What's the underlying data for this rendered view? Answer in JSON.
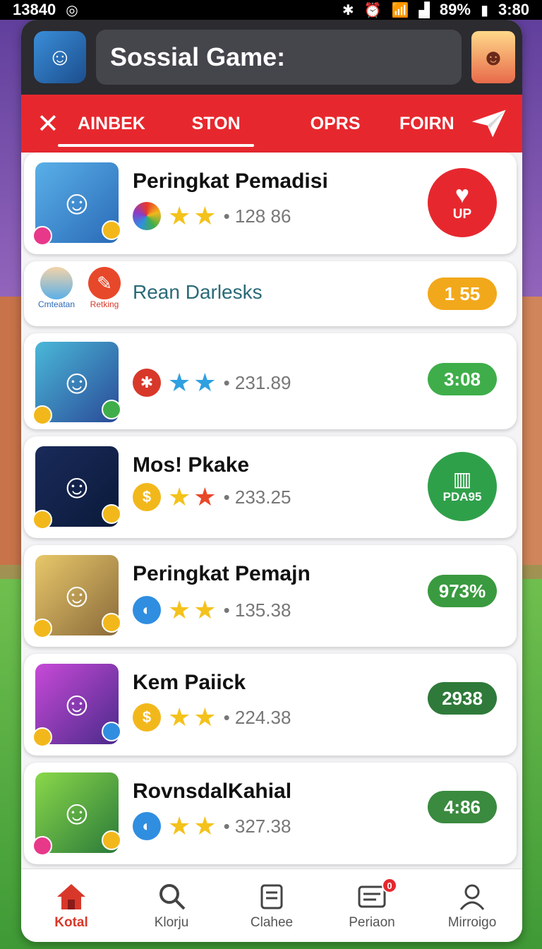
{
  "status_bar": {
    "left_text": "13840",
    "right_battery": "89%",
    "right_time": "3:80"
  },
  "header": {
    "title": "Sossial Game:",
    "app_icon": "player-avatar-icon",
    "profile_icon": "profile-avatar-icon"
  },
  "tabs": {
    "close_icon": "close-icon",
    "items": [
      "AINBEK",
      "STON",
      "OPRS",
      "FOIRN"
    ],
    "active_index": 0,
    "send_icon": "send-icon"
  },
  "list": [
    {
      "title": "Peringkat Pemadisi",
      "score": "128 86",
      "coin_color": "#8a3cc8",
      "stars": [
        "#f4c21b",
        "#f4c21b"
      ],
      "action_type": "circle",
      "action_text": "UP",
      "action_color": "#e6282e",
      "thumb_color": "#3a8ed8"
    },
    {
      "type": "recommend",
      "label_left": "Cmteatan",
      "label_mid": "Retking",
      "title": "Rean Darlesks",
      "action_text": "1 55",
      "action_color": "#f2a81b"
    },
    {
      "title": "",
      "score": "231.89",
      "coin_color": "#d8382a",
      "stars": [
        "#2fa0e0",
        "#2fa0e0"
      ],
      "action_type": "pill",
      "action_text": "3:08",
      "action_color": "#3fae4a",
      "thumb_color": "#4aa0d8"
    },
    {
      "title": "Mos! Pkake",
      "score": "233.25",
      "coin_color": "#f2b81b",
      "stars": [
        "#f4c21b",
        "#e8482a"
      ],
      "action_type": "circle",
      "action_text": "PDA95",
      "action_color": "#2fa04a",
      "thumb_color": "#1a2a4a"
    },
    {
      "title": "Peringkat Pemajn",
      "score": "135.38",
      "coin_color": "#2f8ee0",
      "stars": [
        "#f4c21b",
        "#f4c21b"
      ],
      "action_type": "pill",
      "action_text": "973%",
      "action_color": "#3a9a3f",
      "thumb_color": "#c89a4a"
    },
    {
      "title": "Kem Paiick",
      "score": "224.38",
      "coin_color": "#f2b81b",
      "stars": [
        "#f4c21b",
        "#f4c21b"
      ],
      "action_type": "pill",
      "action_text": "2938",
      "action_color": "#2f7a3a",
      "thumb_color": "#a84ab8"
    },
    {
      "title": "RovnsdalKahial",
      "score": "327.38",
      "coin_color": "#2f8ee0",
      "stars": [
        "#f4c21b",
        "#f4c21b"
      ],
      "action_type": "pill",
      "action_text": "4:86",
      "action_color": "#3a8a3f",
      "thumb_color": "#6ab84a"
    }
  ],
  "bottom_nav": [
    {
      "label": "Kotal",
      "icon": "home-icon",
      "active": true
    },
    {
      "label": "Klorju",
      "icon": "search-icon",
      "active": false
    },
    {
      "label": "Clahee",
      "icon": "inbox-icon",
      "active": false
    },
    {
      "label": "Periaon",
      "icon": "messages-icon",
      "active": false,
      "badge": "0"
    },
    {
      "label": "Mirroigo",
      "icon": "profile-icon",
      "active": false
    }
  ]
}
